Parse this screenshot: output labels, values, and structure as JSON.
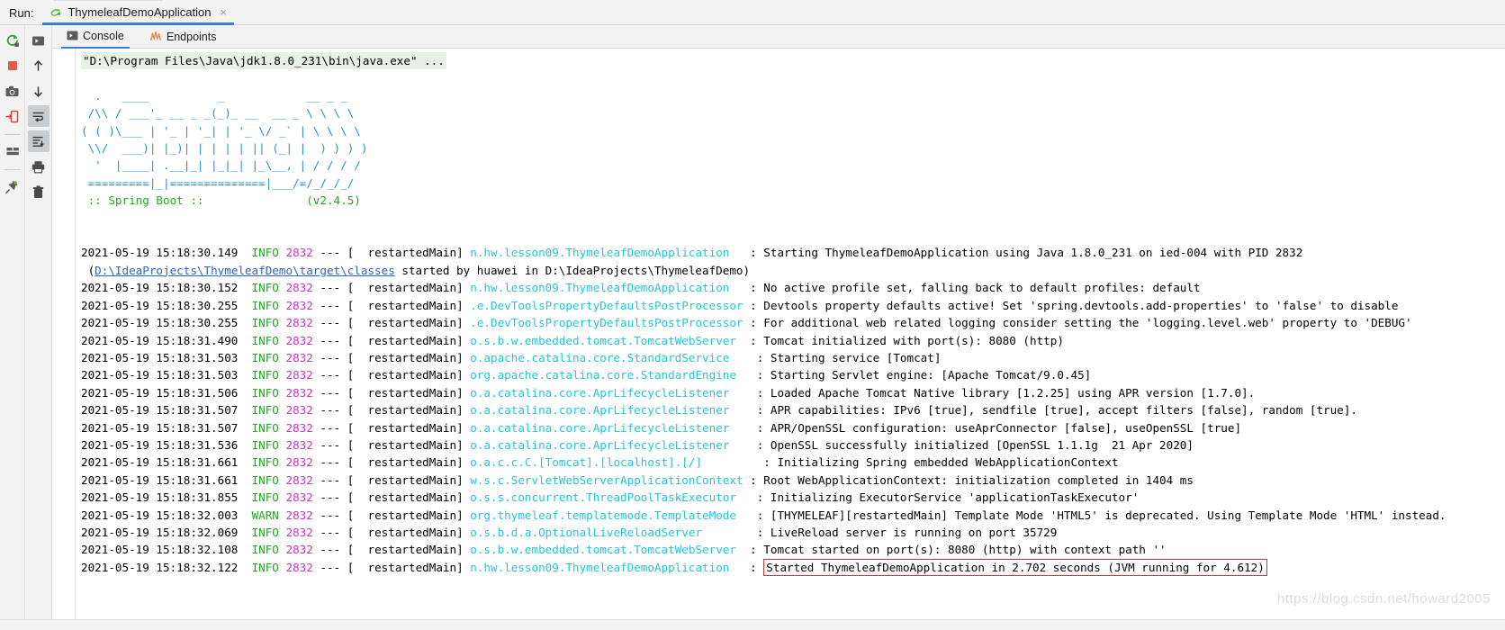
{
  "window": {
    "run_label": "Run:",
    "run_tab_title": "ThymeleafDemoApplication",
    "run_tab_close": "×"
  },
  "left_toolbar": {
    "items": [
      {
        "name": "rerun-icon",
        "tooltip": "Rerun"
      },
      {
        "name": "stop-icon",
        "tooltip": "Stop"
      },
      {
        "name": "camera-icon",
        "tooltip": "Screenshot"
      },
      {
        "name": "thread-dump-icon",
        "tooltip": "Thread Dump"
      },
      {
        "name": "layout-icon",
        "tooltip": "Layout"
      },
      {
        "name": "pin-icon",
        "tooltip": "Pin Tab"
      }
    ]
  },
  "console_toolbar": {
    "items": [
      {
        "name": "console-toggle-icon",
        "tooltip": "Console"
      },
      {
        "name": "arrow-up-icon",
        "tooltip": "Up the Stack Trace"
      },
      {
        "name": "arrow-down-icon",
        "tooltip": "Down the Stack Trace"
      },
      {
        "name": "soft-wrap-icon",
        "tooltip": "Soft-Wrap",
        "active": true
      },
      {
        "name": "scroll-to-end-icon",
        "tooltip": "Scroll to End",
        "active": true
      },
      {
        "name": "print-icon",
        "tooltip": "Print"
      },
      {
        "name": "trash-icon",
        "tooltip": "Clear All"
      }
    ]
  },
  "tabs": [
    {
      "label": "Console",
      "icon": "console-icon",
      "selected": true
    },
    {
      "label": "Endpoints",
      "icon": "endpoints-icon",
      "selected": false
    }
  ],
  "console": {
    "command_line": "\"D:\\Program Files\\Java\\jdk1.8.0_231\\bin\\java.exe\" ...",
    "banner_lines": [
      "  .   ____          _            __ _ _",
      " /\\\\ / ___'_ __ _ _(_)_ __  __ _ \\ \\ \\ \\",
      "( ( )\\___ | '_ | '_| | '_ \\/ _` | \\ \\ \\ \\",
      " \\\\/  ___)| |_)| | | | | || (_| |  ) ) ) )",
      "  '  |____| .__|_| |_|_| |_\\__, | / / / /",
      " =========|_|==============|___/=/_/_/_/"
    ],
    "spring_boot_label": " :: Spring Boot :: ",
    "spring_boot_version": "(v2.4.5)",
    "wrapped_line": {
      "prefix": " (",
      "link": "D:\\IdeaProjects\\ThymeleafDemo\\target\\classes",
      "suffix": " started by huawei in D:\\IdeaProjects\\ThymeleafDemo)"
    },
    "watermark": "https://blog.csdn.net/howard2005",
    "highlight_color": "#e03131",
    "log_lines": [
      {
        "timestamp": "2021-05-19 15:18:30.149",
        "level": "INFO",
        "pid": "2832",
        "thread": "restartedMain",
        "logger": "n.hw.lesson09.ThymeleafDemoApplication",
        "logger_pad": "  ",
        "message": "Starting ThymeleafDemoApplication using Java 1.8.0_231 on ied-004 with PID 2832"
      },
      {
        "timestamp": "2021-05-19 15:18:30.152",
        "level": "INFO",
        "pid": "2832",
        "thread": "restartedMain",
        "logger": "n.hw.lesson09.ThymeleafDemoApplication",
        "logger_pad": "  ",
        "message": "No active profile set, falling back to default profiles: default"
      },
      {
        "timestamp": "2021-05-19 15:18:30.255",
        "level": "INFO",
        "pid": "2832",
        "thread": "restartedMain",
        "logger": ".e.DevToolsPropertyDefaultsPostProcessor",
        "logger_pad": "",
        "message": "Devtools property defaults active! Set 'spring.devtools.add-properties' to 'false' to disable"
      },
      {
        "timestamp": "2021-05-19 15:18:30.255",
        "level": "INFO",
        "pid": "2832",
        "thread": "restartedMain",
        "logger": ".e.DevToolsPropertyDefaultsPostProcessor",
        "logger_pad": "",
        "message": "For additional web related logging consider setting the 'logging.level.web' property to 'DEBUG'"
      },
      {
        "timestamp": "2021-05-19 15:18:31.490",
        "level": "INFO",
        "pid": "2832",
        "thread": "restartedMain",
        "logger": "o.s.b.w.embedded.tomcat.TomcatWebServer",
        "logger_pad": " ",
        "message": "Tomcat initialized with port(s): 8080 (http)"
      },
      {
        "timestamp": "2021-05-19 15:18:31.503",
        "level": "INFO",
        "pid": "2832",
        "thread": "restartedMain",
        "logger": "o.apache.catalina.core.StandardService",
        "logger_pad": "   ",
        "message": "Starting service [Tomcat]"
      },
      {
        "timestamp": "2021-05-19 15:18:31.503",
        "level": "INFO",
        "pid": "2832",
        "thread": "restartedMain",
        "logger": "org.apache.catalina.core.StandardEngine",
        "logger_pad": "  ",
        "message": "Starting Servlet engine: [Apache Tomcat/9.0.45]"
      },
      {
        "timestamp": "2021-05-19 15:18:31.506",
        "level": "INFO",
        "pid": "2832",
        "thread": "restartedMain",
        "logger": "o.a.catalina.core.AprLifecycleListener",
        "logger_pad": "   ",
        "message": "Loaded Apache Tomcat Native library [1.2.25] using APR version [1.7.0]."
      },
      {
        "timestamp": "2021-05-19 15:18:31.507",
        "level": "INFO",
        "pid": "2832",
        "thread": "restartedMain",
        "logger": "o.a.catalina.core.AprLifecycleListener",
        "logger_pad": "   ",
        "message": "APR capabilities: IPv6 [true], sendfile [true], accept filters [false], random [true]."
      },
      {
        "timestamp": "2021-05-19 15:18:31.507",
        "level": "INFO",
        "pid": "2832",
        "thread": "restartedMain",
        "logger": "o.a.catalina.core.AprLifecycleListener",
        "logger_pad": "   ",
        "message": "APR/OpenSSL configuration: useAprConnector [false], useOpenSSL [true]"
      },
      {
        "timestamp": "2021-05-19 15:18:31.536",
        "level": "INFO",
        "pid": "2832",
        "thread": "restartedMain",
        "logger": "o.a.catalina.core.AprLifecycleListener",
        "logger_pad": "   ",
        "message": "OpenSSL successfully initialized [OpenSSL 1.1.1g  21 Apr 2020]"
      },
      {
        "timestamp": "2021-05-19 15:18:31.661",
        "level": "INFO",
        "pid": "2832",
        "thread": "restartedMain",
        "logger": "o.a.c.c.C.[Tomcat].[localhost].[/]",
        "logger_pad": "        ",
        "message": "Initializing Spring embedded WebApplicationContext"
      },
      {
        "timestamp": "2021-05-19 15:18:31.661",
        "level": "INFO",
        "pid": "2832",
        "thread": "restartedMain",
        "logger": "w.s.c.ServletWebServerApplicationContext",
        "logger_pad": "",
        "message": "Root WebApplicationContext: initialization completed in 1404 ms"
      },
      {
        "timestamp": "2021-05-19 15:18:31.855",
        "level": "INFO",
        "pid": "2832",
        "thread": "restartedMain",
        "logger": "o.s.s.concurrent.ThreadPoolTaskExecutor",
        "logger_pad": "  ",
        "message": "Initializing ExecutorService 'applicationTaskExecutor'"
      },
      {
        "timestamp": "2021-05-19 15:18:32.003",
        "level": "WARN",
        "pid": "2832",
        "thread": "restartedMain",
        "logger": "org.thymeleaf.templatemode.TemplateMode",
        "logger_pad": "  ",
        "message": "[THYMELEAF][restartedMain] Template Mode 'HTML5' is deprecated. Using Template Mode 'HTML' instead."
      },
      {
        "timestamp": "2021-05-19 15:18:32.069",
        "level": "INFO",
        "pid": "2832",
        "thread": "restartedMain",
        "logger": "o.s.b.d.a.OptionalLiveReloadServer",
        "logger_pad": "       ",
        "message": "LiveReload server is running on port 35729"
      },
      {
        "timestamp": "2021-05-19 15:18:32.108",
        "level": "INFO",
        "pid": "2832",
        "thread": "restartedMain",
        "logger": "o.s.b.w.embedded.tomcat.TomcatWebServer",
        "logger_pad": " ",
        "message": "Tomcat started on port(s): 8080 (http) with context path ''"
      },
      {
        "timestamp": "2021-05-19 15:18:32.122",
        "level": "INFO",
        "pid": "2832",
        "thread": "restartedMain",
        "logger": "n.hw.lesson09.ThymeleafDemoApplication",
        "logger_pad": "  ",
        "message": "Started ThymeleafDemoApplication in 2.702 seconds (JVM running for 4.612)",
        "highlighted": true
      }
    ]
  }
}
